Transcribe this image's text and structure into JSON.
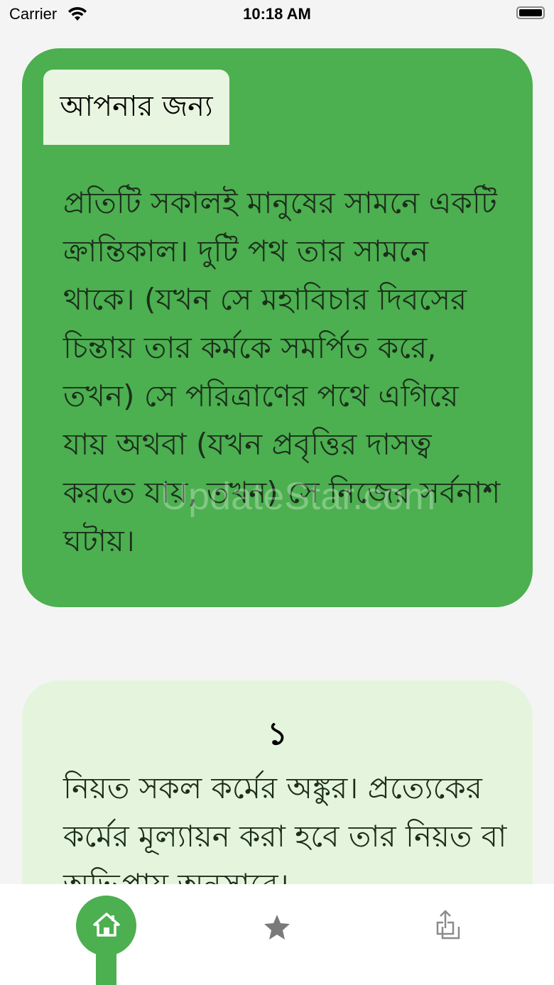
{
  "status_bar": {
    "carrier": "Carrier",
    "time": "10:18 AM"
  },
  "featured": {
    "label": "আপনার জন্য",
    "text": "প্রতিটি সকালই মানুষের সামনে একটি ক্রান্তিকাল। দুটি পথ তার সামনে থাকে। (যখন সে মহাবিচার দিবসের চিন্তায় তার কর্মকে সমর্পিত করে, তখন) সে পরিত্রাণের পথে এগিয়ে যায় অথবা (যখন প্রবৃত্তির দাসত্ব করতে যায়, তখন) সে নিজের সর্বনাশ ঘটায়।",
    "watermark": "UpdateStar.com"
  },
  "hadith": {
    "number": "১",
    "text": "নিয়ত সকল কর্মের অঙ্কুর। প্রত্যেকের কর্মের মূল্যায়ন করা হবে তার নিয়ত বা অভিপ্রায় অনুসারে।"
  },
  "tab_bar": {
    "tabs": [
      {
        "icon": "home-icon",
        "selected": true
      },
      {
        "icon": "star-icon",
        "selected": false
      },
      {
        "icon": "share-icon",
        "selected": false
      }
    ]
  },
  "colors": {
    "accent": "#4caf50",
    "card_light": "#e5f5dd",
    "background": "#f4f4f5"
  }
}
